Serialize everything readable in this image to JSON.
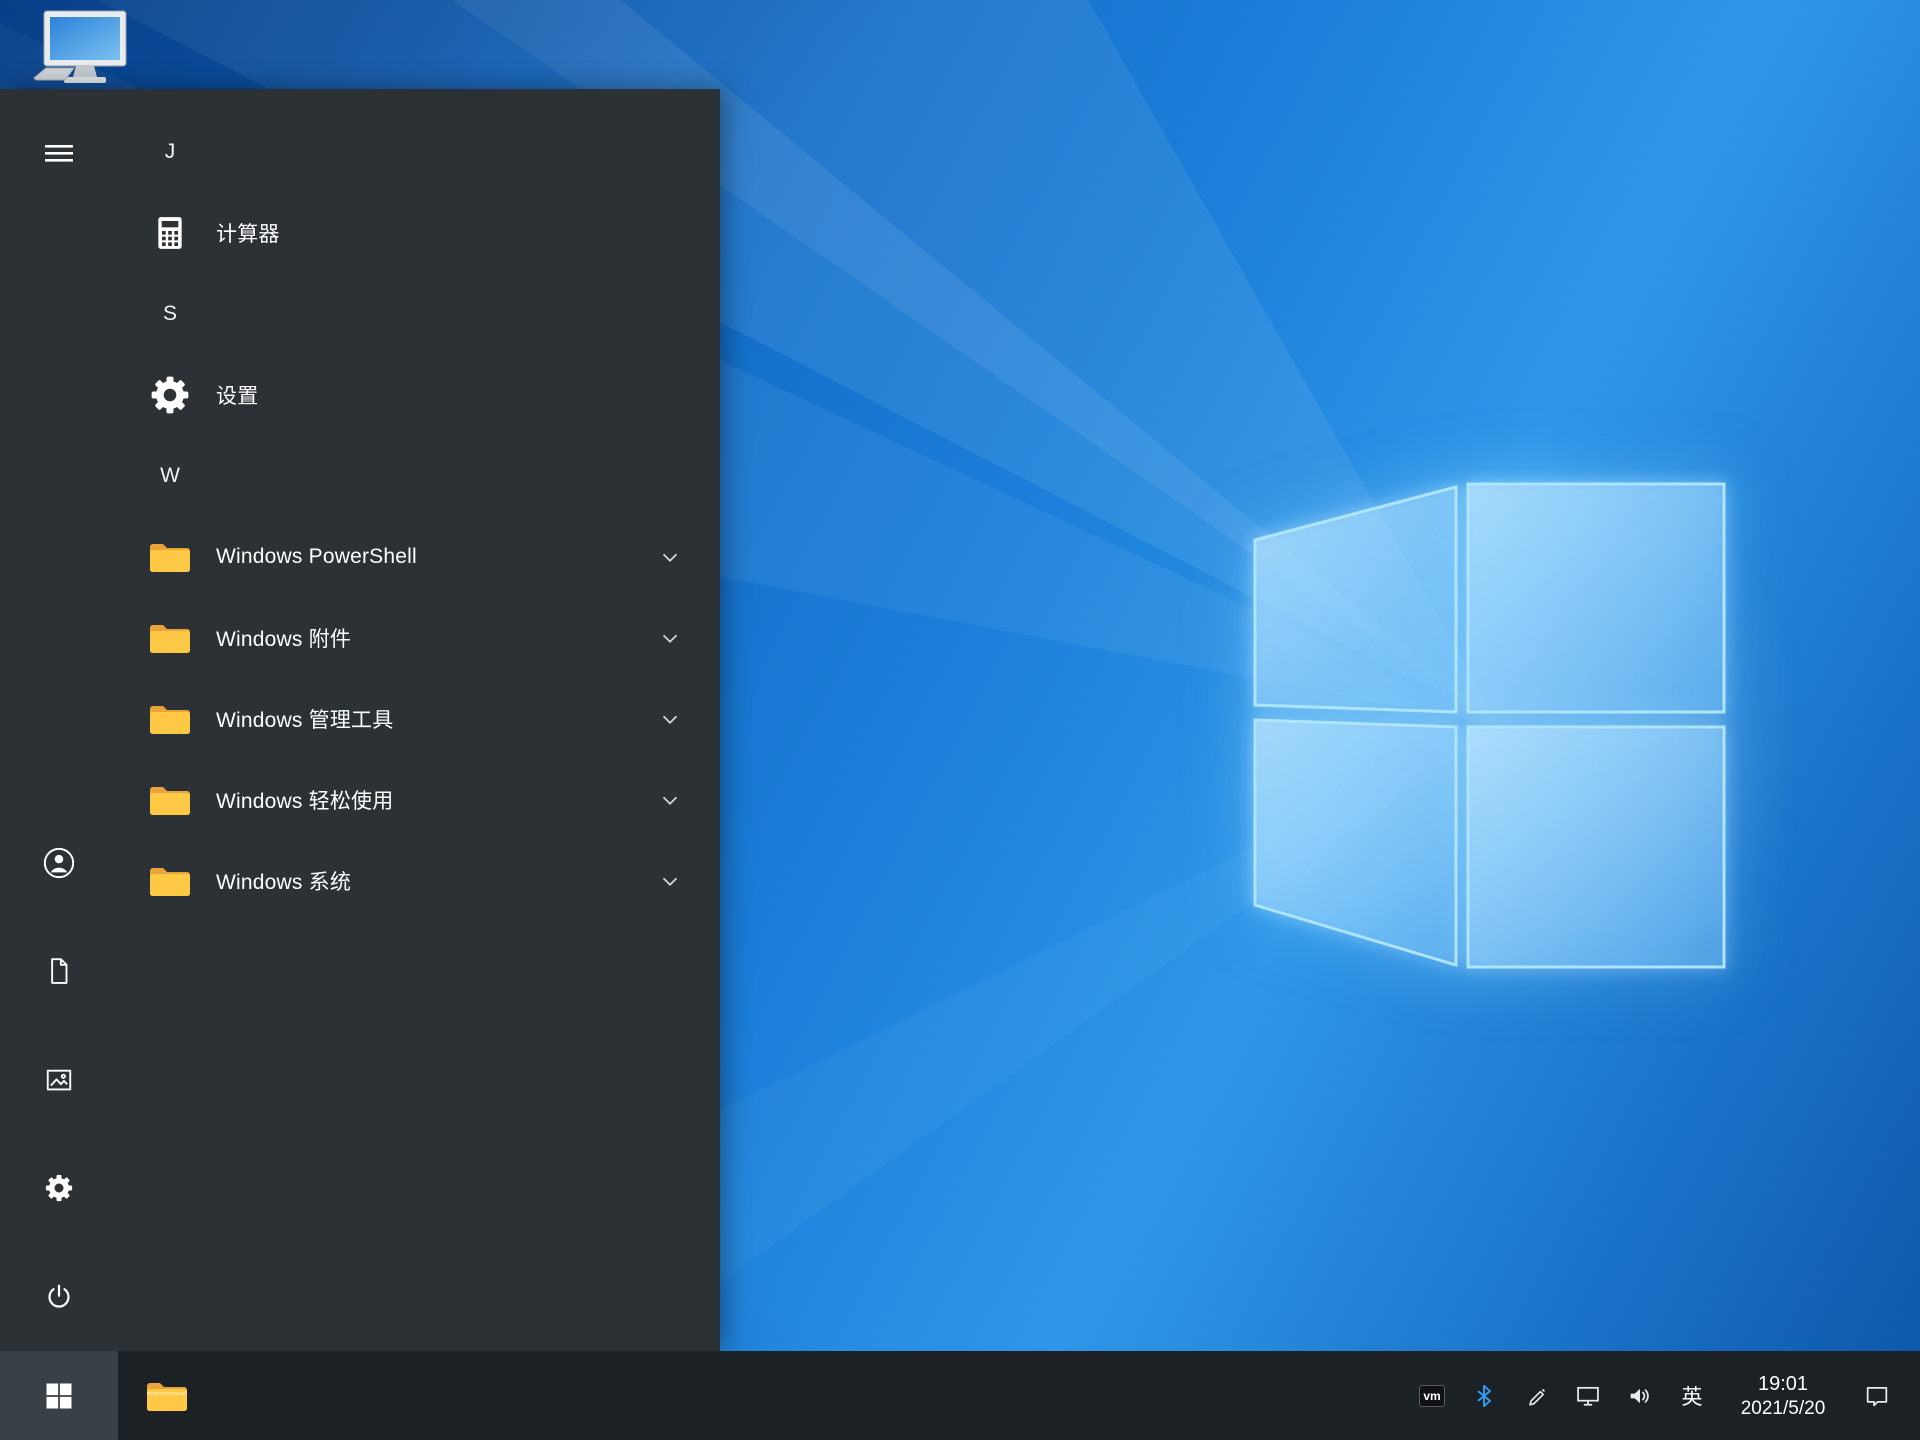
{
  "colors": {
    "accent_blue": "#0078d7",
    "start_menu_bg": "#2b3135",
    "taskbar_bg": "#1c2125",
    "start_button_pressed_bg": "#3a4146",
    "folder_yellow": "#ffc845",
    "folder_tab_orange": "#e9a33b",
    "bluetooth_blue": "#2f9df4",
    "wallpaper_blue": "#1b7ed8"
  },
  "desktop": {
    "icons": [
      {
        "name": "this-pc"
      }
    ]
  },
  "start_menu": {
    "rail": {
      "menu_button": "expand-menu",
      "bottom_items": [
        "user-account",
        "documents",
        "pictures",
        "settings",
        "power"
      ]
    },
    "app_list": {
      "items": [
        {
          "type": "letter",
          "label": "J"
        },
        {
          "type": "app",
          "icon": "calculator-icon",
          "label": "计算器"
        },
        {
          "type": "letter",
          "label": "S"
        },
        {
          "type": "app",
          "icon": "settings-gear-icon",
          "label": "设置"
        },
        {
          "type": "letter",
          "label": "W"
        },
        {
          "type": "folder",
          "icon": "folder-icon",
          "label": "Windows PowerShell",
          "has_chevron": true
        },
        {
          "type": "folder",
          "icon": "folder-icon",
          "label": "Windows 附件",
          "has_chevron": true
        },
        {
          "type": "folder",
          "icon": "folder-icon",
          "label": "Windows 管理工具",
          "has_chevron": true
        },
        {
          "type": "folder",
          "icon": "folder-icon",
          "label": "Windows 轻松使用",
          "has_chevron": true
        },
        {
          "type": "folder",
          "icon": "folder-icon",
          "label": "Windows 系统",
          "has_chevron": true
        }
      ]
    }
  },
  "taskbar": {
    "start_button": {
      "icon": "windows-logo"
    },
    "pinned": [
      {
        "icon": "file-explorer"
      }
    ],
    "tray": {
      "vm_badge": "vm",
      "ime_indicator": "英",
      "clock": {
        "time": "19:01",
        "date": "2021/5/20"
      }
    }
  }
}
